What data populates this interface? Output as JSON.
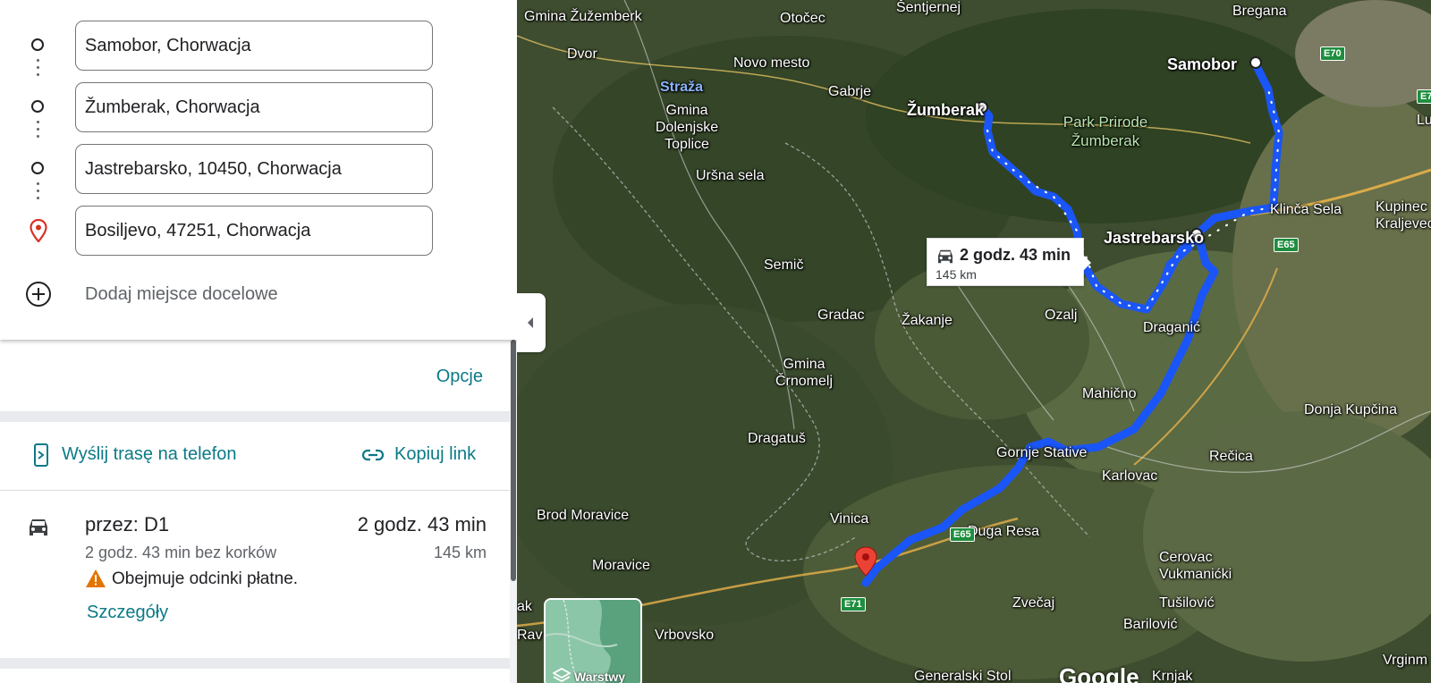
{
  "waypoints": [
    {
      "value": "Samobor, Chorwacja",
      "icon": "origin-circle-icon"
    },
    {
      "value": "Žumberak, Chorwacja",
      "icon": "waypoint-circle-icon"
    },
    {
      "value": "Jastrebarsko, 10450, Chorwacja",
      "icon": "waypoint-circle-icon"
    },
    {
      "value": "Bosiljevo, 47251, Chorwacja",
      "icon": "destination-pin-icon"
    }
  ],
  "add_destination": {
    "label": "Dodaj miejsce docelowe",
    "icon": "add-circle-icon"
  },
  "options": {
    "label": "Opcje"
  },
  "share": {
    "send_to_phone": "Wyślij trasę na telefon",
    "copy_link": "Kopiuj link"
  },
  "route": {
    "via": "przez: D1",
    "time": "2 godz. 43 min",
    "no_traffic": "2 godz. 43 min bez korków",
    "distance": "145 km",
    "warning": "Obejmuje odcinki płatne.",
    "details": "Szczegóły"
  },
  "map": {
    "tooltip_time": "2 godz. 43 min",
    "tooltip_distance": "145 km",
    "layers_label": "Warstwy",
    "logo": "Google",
    "route_color": "#1a55f7",
    "labels": {
      "samobor": "Samobor",
      "zumberak": "Žumberak",
      "jastrebarsko": "Jastrebarsko",
      "park": "Park Prirode Žumberak",
      "gmina_zuzemberk": "Gmina Žužemberk",
      "otocec": "Otočec",
      "sentjernej": "Šentjernej",
      "bregana": "Bregana",
      "dvor": "Dvor",
      "novo_mesto": "Novo mesto",
      "straza": "Straža",
      "gabrje": "Gabrje",
      "gmina_dolenjske": "Gmina Dolenjske Toplice",
      "ursna_sela": "Uršna sela",
      "klinca_sela": "Klinča Sela",
      "kupinec": "Kupinec Kraljevec",
      "semic": "Semič",
      "gradac": "Gradac",
      "zakanje": "Žakanje",
      "ozalj": "Ozalj",
      "draganic": "Draganić",
      "gmina_crnomelj": "Gmina Črnomelj",
      "mahicno": "Mahično",
      "donja_kupcina": "Donja Kupčina",
      "dragatus": "Dragatuš",
      "gornje_stative": "Gornje Stative",
      "karlovac": "Karlovac",
      "recica": "Rečica",
      "brod_moravice": "Brod Moravice",
      "vinica": "Vinica",
      "duga_resa": "Duga Resa",
      "moravice": "Moravice",
      "cerovac": "Cerovac Vukmanićki",
      "zvecaj": "Zvečaj",
      "tusilovic": "Tušilović",
      "barilovic": "Barilović",
      "vrbovsko": "Vrbovsko",
      "generalski_stol": "Generalski Stol",
      "krnjak": "Krnjak",
      "vrginmost": "Vrginm",
      "rav": "Rav",
      "ak": "ak",
      "l_right": "Lu"
    },
    "shields": {
      "e70": "E70",
      "e65a": "E65",
      "e65b": "E65",
      "e71": "E71",
      "e7": "E7"
    }
  }
}
